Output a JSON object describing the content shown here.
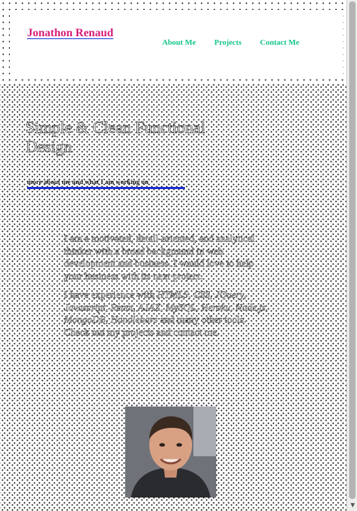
{
  "header": {
    "brand": "Jonathon Renaud",
    "nav": [
      "About Me",
      "Projects",
      "Contact Me"
    ]
  },
  "hero": {
    "title": "Simple & Clean Functional Design",
    "link": "more about me and what I am working on"
  },
  "about": {
    "para1": "I am a motivated, detail-oriented, and analytical thinker with a broad background in web development and business. I would love to help your business with its next project.",
    "skills_intro": "I have experience with",
    "skills": "HTML5, CSS, JQuery, Javascript, React, AJAX, MySQL, Heroku, Node.js, MongoDB, Handlebars",
    "skills_outro": "and many other tools. Check out my projects and contact me."
  },
  "portrait": {
    "alt": "portrait-photo"
  },
  "colors": {
    "brand": "#d81b7a",
    "nav": "#12c48c",
    "link_underline": "#1c2bd9"
  }
}
